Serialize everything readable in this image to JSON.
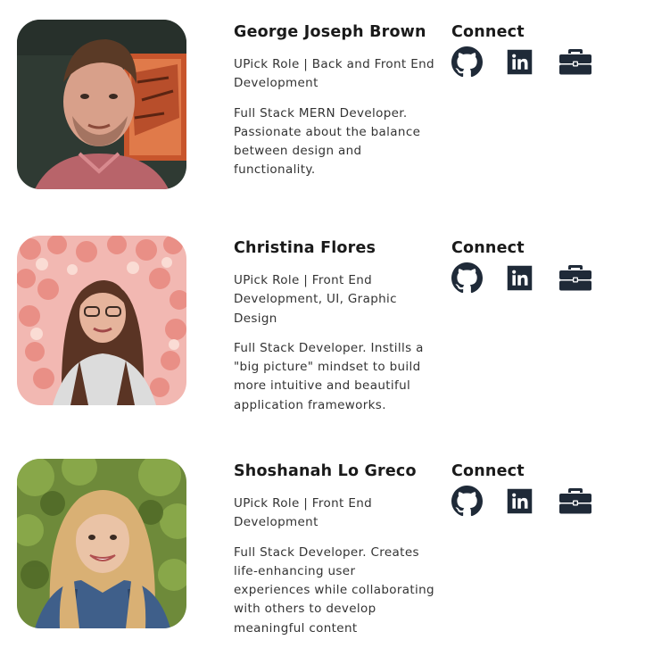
{
  "colors": {
    "icon": "#1f2a38",
    "text": "#333333",
    "heading": "#1a1a1a"
  },
  "icons": [
    "github-icon",
    "linkedin-icon",
    "briefcase-icon"
  ],
  "team": [
    {
      "name": "George Joseph Brown",
      "role": "UPick Role | Back and Front End Development",
      "bio": "Full Stack MERN Developer. Passionate about the balance between design and functionality.",
      "connect_title": "Connect"
    },
    {
      "name": "Christina Flores",
      "role": "UPick Role | Front End Development, UI, Graphic Design",
      "bio": "Full Stack Developer. Instills a \"big picture\" mindset to build more intuitive and beautiful application frameworks.",
      "connect_title": "Connect"
    },
    {
      "name": "Shoshanah Lo Greco",
      "role": "UPick Role | Front End Development",
      "bio": "Full Stack Developer. Creates life-enhancing user experiences while collaborating with others to develop meaningful content",
      "connect_title": "Connect"
    }
  ]
}
